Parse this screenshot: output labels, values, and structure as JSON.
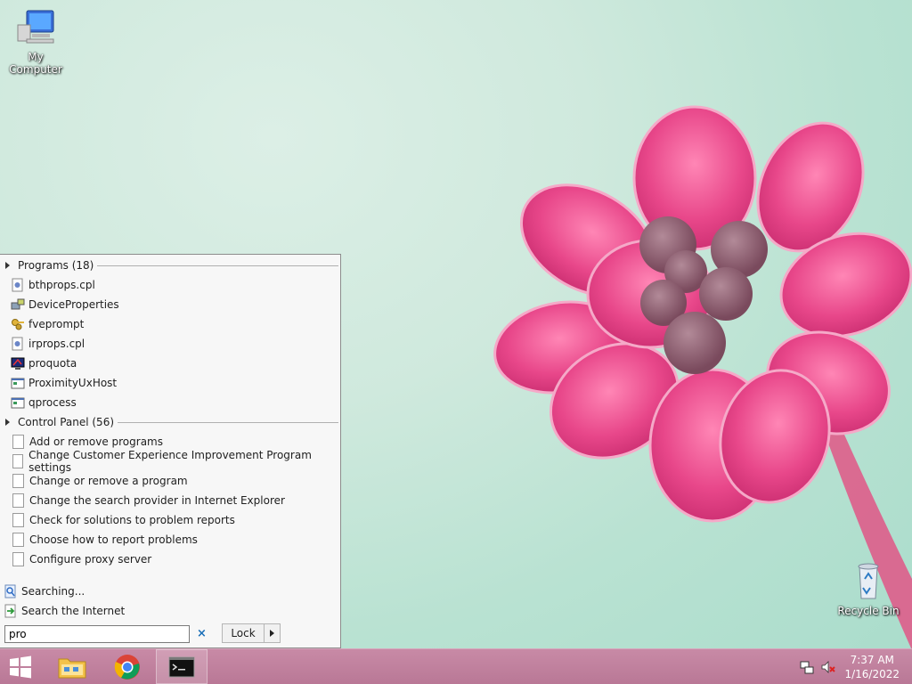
{
  "desktop": {
    "icons": [
      {
        "label": "My Computer",
        "icon": "computer-icon"
      },
      {
        "label": "Recycle Bin",
        "icon": "recycle-bin-icon"
      }
    ]
  },
  "start_menu": {
    "programs_header": "Programs (18)",
    "programs": [
      {
        "label": "bthprops.cpl",
        "icon": "settings-file-icon"
      },
      {
        "label": "DeviceProperties",
        "icon": "devices-icon"
      },
      {
        "label": "fveprompt",
        "icon": "keys-icon"
      },
      {
        "label": "irprops.cpl",
        "icon": "settings-file-icon"
      },
      {
        "label": "proquota",
        "icon": "monitor-icon"
      },
      {
        "label": "ProximityUxHost",
        "icon": "window-icon"
      },
      {
        "label": "qprocess",
        "icon": "window-icon"
      }
    ],
    "control_panel_header": "Control Panel (56)",
    "control_panel": [
      {
        "label": "Add or remove programs"
      },
      {
        "label": "Change Customer Experience Improvement Program settings"
      },
      {
        "label": "Change or remove a program"
      },
      {
        "label": "Change the search provider in Internet Explorer"
      },
      {
        "label": "Check for solutions to problem reports"
      },
      {
        "label": "Choose how to report problems"
      },
      {
        "label": "Configure proxy server"
      }
    ],
    "searching_label": "Searching...",
    "search_internet_label": "Search the Internet",
    "search_value": "pro",
    "clear_label": "×",
    "lock_label": "Lock"
  },
  "taskbar": {
    "time": "7:37 AM",
    "date": "1/16/2022"
  },
  "colors": {
    "taskbar": "#c08099",
    "flower": "#e24a8a"
  }
}
